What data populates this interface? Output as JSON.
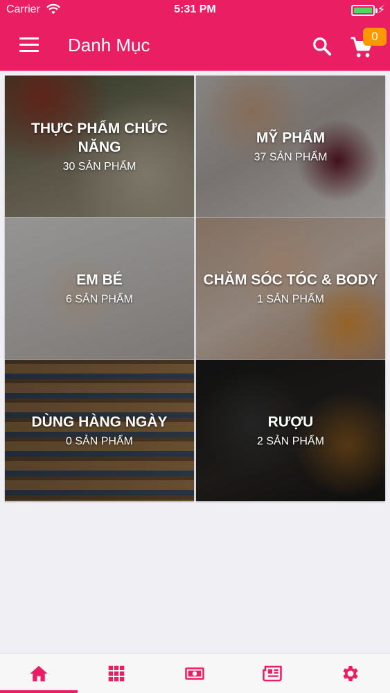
{
  "status_bar": {
    "carrier": "Carrier",
    "time": "5:31 PM"
  },
  "header": {
    "title": "Danh Mục",
    "cart_count": "0"
  },
  "categories": [
    {
      "name": "THỰC PHẨM CHỨC NĂNG",
      "count": "30 SẢN PHẨM"
    },
    {
      "name": "MỸ PHẨM",
      "count": "37 SẢN PHẨM"
    },
    {
      "name": "EM BÉ",
      "count": "6 SẢN PHẨM"
    },
    {
      "name": "CHĂM SÓC TÓC & BODY",
      "count": "1 SẢN PHẨM"
    },
    {
      "name": "DÙNG HÀNG NGÀY",
      "count": "0 SẢN PHẨM"
    },
    {
      "name": "RƯỢU",
      "count": "2 SẢN PHẨM"
    }
  ],
  "tabs": [
    {
      "icon": "home-icon",
      "active": true
    },
    {
      "icon": "grid-icon",
      "active": false
    },
    {
      "icon": "money-icon",
      "active": false
    },
    {
      "icon": "newspaper-icon",
      "active": false
    },
    {
      "icon": "gear-icon",
      "active": false
    }
  ],
  "colors": {
    "primary": "#e91e63",
    "badge": "#ff9800",
    "battery": "#4cd964"
  }
}
